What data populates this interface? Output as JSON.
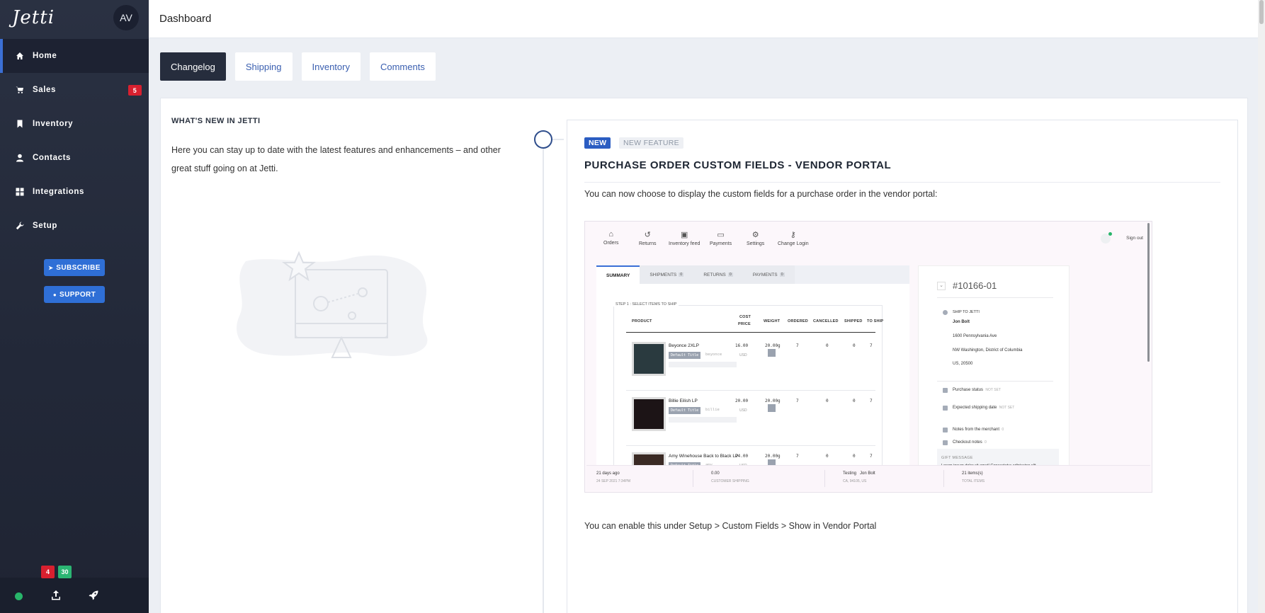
{
  "app": {
    "logo": "Jetti",
    "avatar_initials": "AV"
  },
  "sidebar": {
    "items": [
      {
        "label": "Home",
        "icon": "home-icon",
        "active": true
      },
      {
        "label": "Sales",
        "icon": "cart-icon",
        "badge": "5"
      },
      {
        "label": "Inventory",
        "icon": "bookmark-icon"
      },
      {
        "label": "Contacts",
        "icon": "user-icon"
      },
      {
        "label": "Integrations",
        "icon": "grid-icon"
      },
      {
        "label": "Setup",
        "icon": "wrench-icon"
      }
    ],
    "subscribe_label": "SUBSCRIBE",
    "support_label": "SUPPORT",
    "bottom": {
      "upload_badge": "4",
      "rocket_badge": "30"
    }
  },
  "header": {
    "title": "Dashboard"
  },
  "tabs": [
    {
      "label": "Changelog",
      "active": true
    },
    {
      "label": "Shipping"
    },
    {
      "label": "Inventory"
    },
    {
      "label": "Comments"
    }
  ],
  "whats_new": {
    "title": "WHAT'S NEW IN JETTI",
    "description": "Here you can stay up to date with the latest features and enhancements – and other great stuff going on at Jetti."
  },
  "entry": {
    "badge_new": "NEW",
    "badge_type": "NEW FEATURE",
    "title": "PURCHASE ORDER CUSTOM FIELDS - VENDOR PORTAL",
    "text": "You can now choose to display the custom fields for a purchase order in the vendor portal:",
    "footer": "You can enable this under Setup > Custom Fields > Show in Vendor Portal"
  },
  "screenshot": {
    "nav": [
      "Orders",
      "Returns",
      "Inventory feed",
      "Payments",
      "Settings",
      "Change Login"
    ],
    "sign_out": "Sign out",
    "tabs": [
      {
        "label": "SUMMARY"
      },
      {
        "label": "SHIPMENTS",
        "count": "0"
      },
      {
        "label": "RETURNS",
        "count": "0"
      },
      {
        "label": "PAYMENTS",
        "count": "0"
      }
    ],
    "step": "STEP 1 : SELECT ITEMS TO SHIP",
    "headers": {
      "product": "PRODUCT",
      "cost": "COST",
      "price": "PRICE",
      "weight": "WEIGHT",
      "ordered": "ORDERED",
      "cancelled": "CANCELLED",
      "shipped": "SHIPPED",
      "to_ship": "TO SHIP"
    },
    "rows": [
      {
        "name": "Beyonce 2XLP",
        "tag": "Default Title",
        "sku": "beyonce",
        "price": "16.00",
        "currency": "USD",
        "weight": "20.00g",
        "ordered": "7",
        "cancelled": "0",
        "shipped": "0",
        "to_ship": "7"
      },
      {
        "name": "Billie Eilish LP",
        "tag": "Default Title",
        "sku": "billie",
        "price": "20.00",
        "currency": "USD",
        "weight": "20.00g",
        "ordered": "7",
        "cancelled": "0",
        "shipped": "0",
        "to_ship": "7"
      },
      {
        "name": "Amy Winehouse Back to Black LP",
        "tag": "Default Title",
        "sku": "amy",
        "price": "24.00",
        "currency": "USD",
        "weight": "20.00g",
        "ordered": "7",
        "cancelled": "0",
        "shipped": "0",
        "to_ship": "7"
      }
    ],
    "order_number": "#10166-01",
    "ship_to_label": "SHIP TO JETTI",
    "address": [
      "Jon Bolt",
      "1600 Pennsylvania Ave",
      "NW Washington, District of Columbia",
      "US, 20500"
    ],
    "purchase_status": "Purchase status",
    "purchase_status_value": "NOT SET",
    "expected_shipping": "Expected shipping date",
    "expected_shipping_value": "NOT SET",
    "notes_merchant": "Notes from the merchant",
    "notes_merchant_count": "0",
    "checkout_notes": "Checkout notes",
    "checkout_notes_count": "0",
    "gift_title": "GIFT MESSAGE",
    "gift_text": "Lorem ipsum dolor sit amet! Consectetur adipiscing elit,",
    "footer": {
      "age": "21 days ago",
      "date": "24 SEP 2021 7:34PM",
      "shipping_value": "0.00",
      "shipping_label": "CUSTOMER SHIPPING",
      "contact_company": "Testing",
      "contact_name": "Jon Bolt",
      "contact_location": "CA, 94105, US",
      "items_value": "21 items(s)",
      "items_label": "TOTAL ITEMS"
    }
  },
  "colors": {
    "sidebar": "#232a3a",
    "accent": "#2f6fd6",
    "badge_red": "#d8202f",
    "badge_green": "#2bb673",
    "active_tab": "#262d3d"
  }
}
